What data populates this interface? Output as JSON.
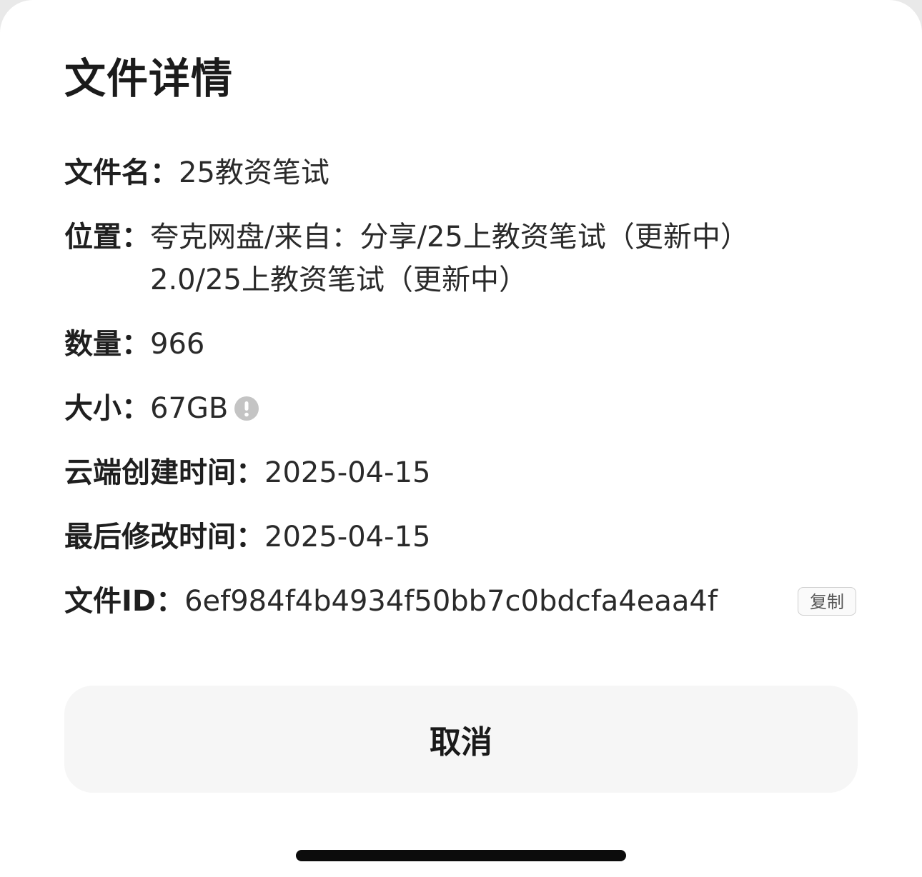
{
  "sheet": {
    "title": "文件详情"
  },
  "details": {
    "filename": {
      "label": "文件名：",
      "value": "25教资笔试"
    },
    "location": {
      "label": "位置：",
      "lines": [
        "夸克网盘/来自：分享/25上教资笔试（更新中）",
        "2.0/25上教资笔试（更新中）"
      ]
    },
    "count": {
      "label": "数量：",
      "value": "966"
    },
    "size": {
      "label": "大小：",
      "value": "67GB",
      "icon": "info-icon"
    },
    "created": {
      "label": "云端创建时间：",
      "value": "2025-04-15"
    },
    "modified": {
      "label": "最后修改时间：",
      "value": "2025-04-15"
    },
    "file_id": {
      "label": "文件ID：",
      "value": "6ef984f4b4934f50bb7c0bdcfa4eaa4f"
    }
  },
  "actions": {
    "copy_label": "复制",
    "cancel_label": "取消"
  },
  "colors": {
    "sheet_bg": "#ffffff",
    "cancel_bg": "#f6f6f6",
    "icon_gray": "#c4c4c4",
    "text": "#1e1e1e"
  }
}
